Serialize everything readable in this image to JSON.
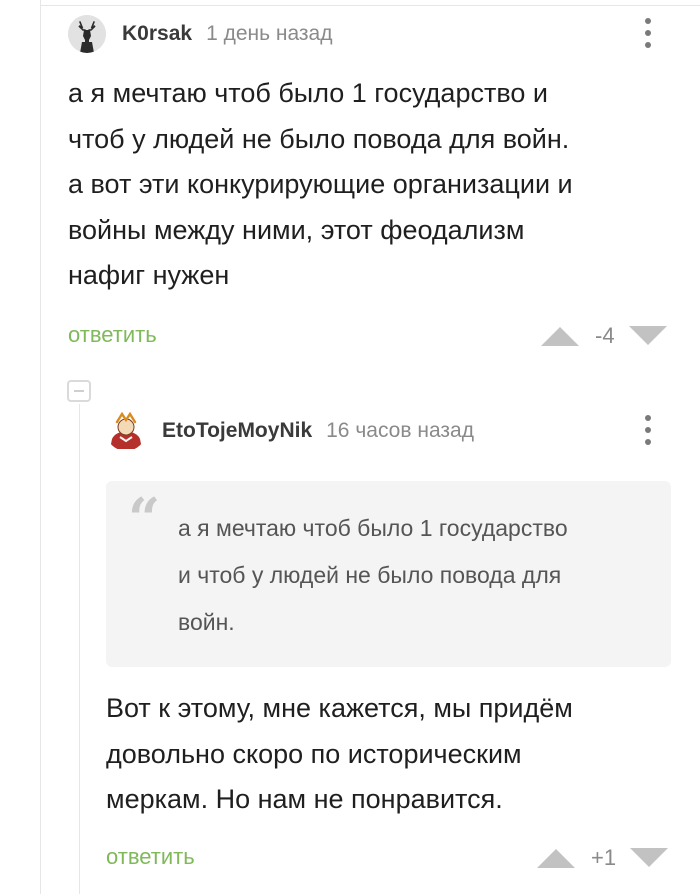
{
  "comment1": {
    "username": "K0rsak",
    "time": "1 день назад",
    "text_lines": [
      "а я мечтаю чтоб было 1 государство и",
      "чтоб у людей не было повода для войн.",
      "а вот эти конкурирующие организации и",
      "войны между ними, этот феодализм",
      "нафиг нужен"
    ],
    "reply_label": "ответить",
    "rating": "-4"
  },
  "comment2": {
    "username": "EtoTojeMoyNik",
    "time": "16 часов назад",
    "quote_lines": [
      "а я мечтаю чтоб было 1 государство",
      "и чтоб у людей не было повода для",
      "войн."
    ],
    "text_lines": [
      "Вот к этому, мне кажется, мы придём",
      "довольно скоро по историческим",
      "меркам. Но нам не понравится."
    ],
    "reply_label": "ответить",
    "rating": "+1"
  },
  "colors": {
    "accent_green": "#7fb95a",
    "vote_gray": "#c2c2c2",
    "meta_gray": "#8a8a8a"
  },
  "icons": {
    "vote_up": "triangle-up-icon",
    "vote_down": "triangle-down-icon",
    "more": "vertical-dots-icon",
    "collapse": "minus-square-icon",
    "quote": "quote-icon"
  }
}
